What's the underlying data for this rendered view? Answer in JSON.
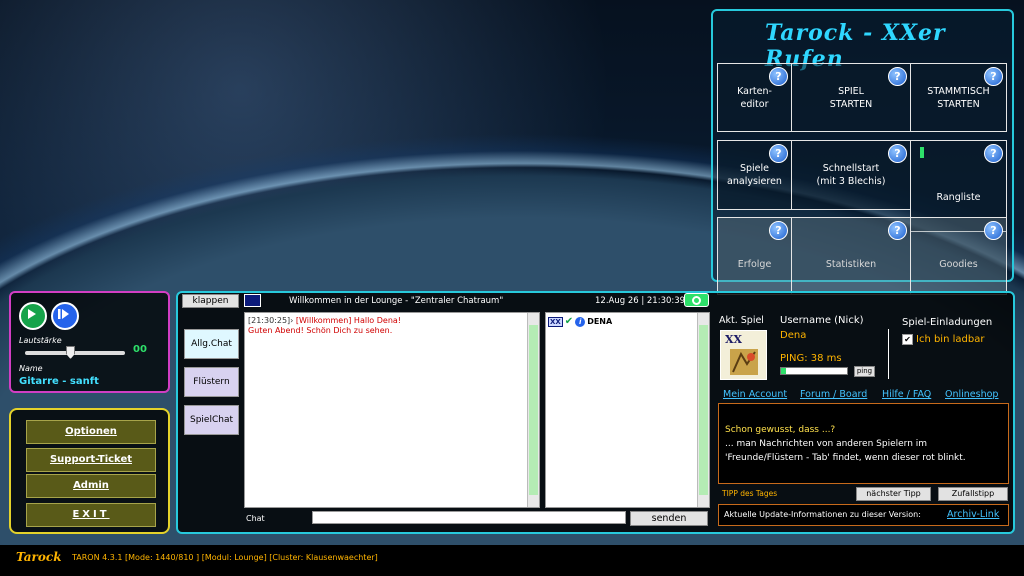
{
  "menu": {
    "logo_text": "Tarock - XXer Rufen",
    "buttons": [
      {
        "label": "Karten-\neditor"
      },
      {
        "label": "SPIEL\nSTARTEN"
      },
      {
        "label": "STAMMTISCH\nSTARTEN"
      },
      {
        "label": "Spiele\nanalysieren"
      },
      {
        "label": "Schnellstart\n(mit 3 Blechis)"
      },
      {
        "label": "Rangliste"
      },
      {
        "label": "Erfolge"
      },
      {
        "label": "Statistiken"
      },
      {
        "label": "Goodies"
      }
    ],
    "help_glyph": "?"
  },
  "player": {
    "volume_label": "Lautstärke",
    "volume_value": "00",
    "volume_level": 0.45,
    "name_label": "Name",
    "track": "Gitarre - sanft"
  },
  "left_menu": {
    "options": "Optionen",
    "support": "Support-Ticket",
    "admin": "Admin",
    "exit": "EXIT"
  },
  "chat": {
    "collapse_label": "klappen",
    "title": "Willkommen in der Lounge - \"Zentraler Chatraum\"",
    "datetime": "12.Aug 26 | 21:30:39",
    "tabs": [
      "Allg.Chat",
      "Flüstern",
      "SpielChat"
    ],
    "messages": [
      {
        "time": "[21:30:25]›",
        "text": "[Willkommen] Hallo Dena!"
      },
      {
        "time": "",
        "text": "Guten Abend! Schön Dich zu sehen."
      }
    ],
    "users": [
      {
        "badge": "XX",
        "name": "DENA"
      }
    ],
    "input_label": "Chat",
    "input_value": "",
    "send_label": "senden"
  },
  "profile": {
    "game_label": "Akt. Spiel",
    "username_label": "Username (Nick)",
    "username": "Dena",
    "ping_label": "PING: 38 ms",
    "ping_button": "ping",
    "ping_level": 0.08,
    "invitations_label": "Spiel-Einladungen",
    "invitable_label": "Ich bin ladbar",
    "invitable_checked": true
  },
  "links": [
    "Mein Account",
    "Forum / Board",
    "Hilfe / FAQ",
    "Onlineshop"
  ],
  "tip": {
    "heading": "Schon gewusst, dass ...?",
    "line1": "... man Nachrichten von anderen Spielern im",
    "line2": "'Freunde/Flüstern - Tab' findet, wenn dieser rot blinkt.",
    "label": "TIPP des Tages",
    "next_button": "nächster Tipp",
    "random_button": "Zufallstipp"
  },
  "update": {
    "text": "Aktuelle Update-Informationen zu dieser Version:",
    "link": "Archiv-Link"
  },
  "footer": {
    "logo": "Tarock",
    "status": "TARON 4.3.1 [Mode: 1440/810 ] [Modul: Lounge] [Cluster: Klausenwaechter]"
  },
  "colors": {
    "cyan_border": "#27c9dc",
    "magenta_border": "#d23ec4",
    "yellow_border": "#e4d22a",
    "orange_text": "#ffb400",
    "link": "#43c3ff"
  }
}
